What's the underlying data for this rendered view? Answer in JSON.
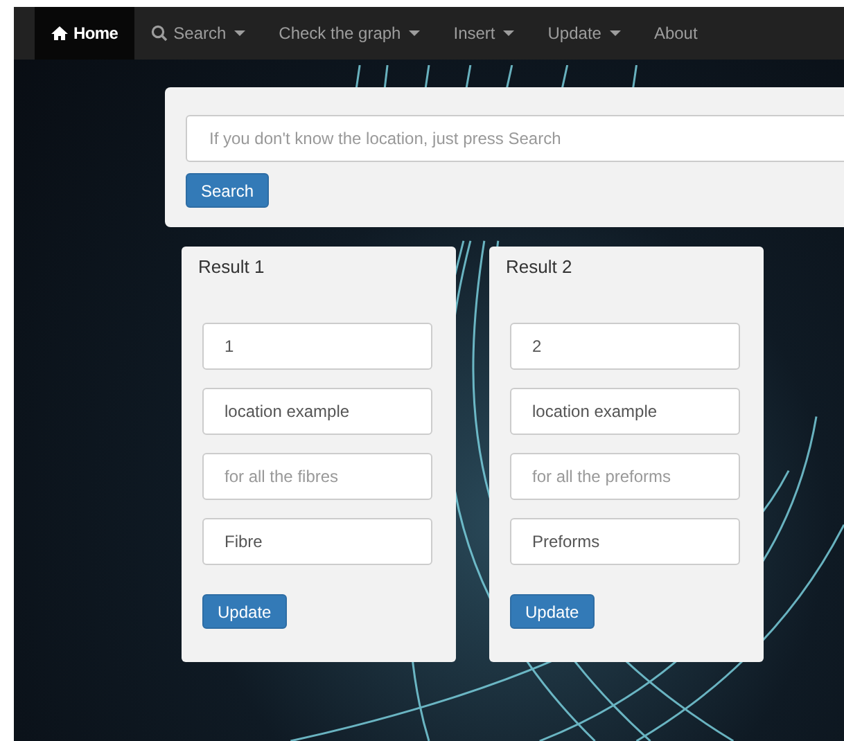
{
  "navbar": {
    "items": [
      {
        "label": "Home",
        "dropdown": false,
        "selected": true
      },
      {
        "label": "Search",
        "dropdown": true,
        "selected": false
      },
      {
        "label": "Check the graph",
        "dropdown": true,
        "selected": false
      },
      {
        "label": "Insert",
        "dropdown": true,
        "selected": false
      },
      {
        "label": "Update",
        "dropdown": true,
        "selected": false
      },
      {
        "label": "About",
        "dropdown": false,
        "selected": false
      }
    ]
  },
  "search_panel": {
    "field": {
      "placeholder": "If you don't know the location, just press Search"
    },
    "button": "Search"
  },
  "results": [
    {
      "title": "Result 1",
      "fields": [
        {
          "value": "1"
        },
        {
          "value": "location example"
        },
        {
          "placeholder": "for all the fibres"
        },
        {
          "value": "Fibre"
        }
      ],
      "button": "Update"
    },
    {
      "title": "Result 2",
      "fields": [
        {
          "value": "2"
        },
        {
          "value": "location example"
        },
        {
          "placeholder": "for all the preforms"
        },
        {
          "value": "Preforms"
        }
      ],
      "button": "Update"
    }
  ]
}
